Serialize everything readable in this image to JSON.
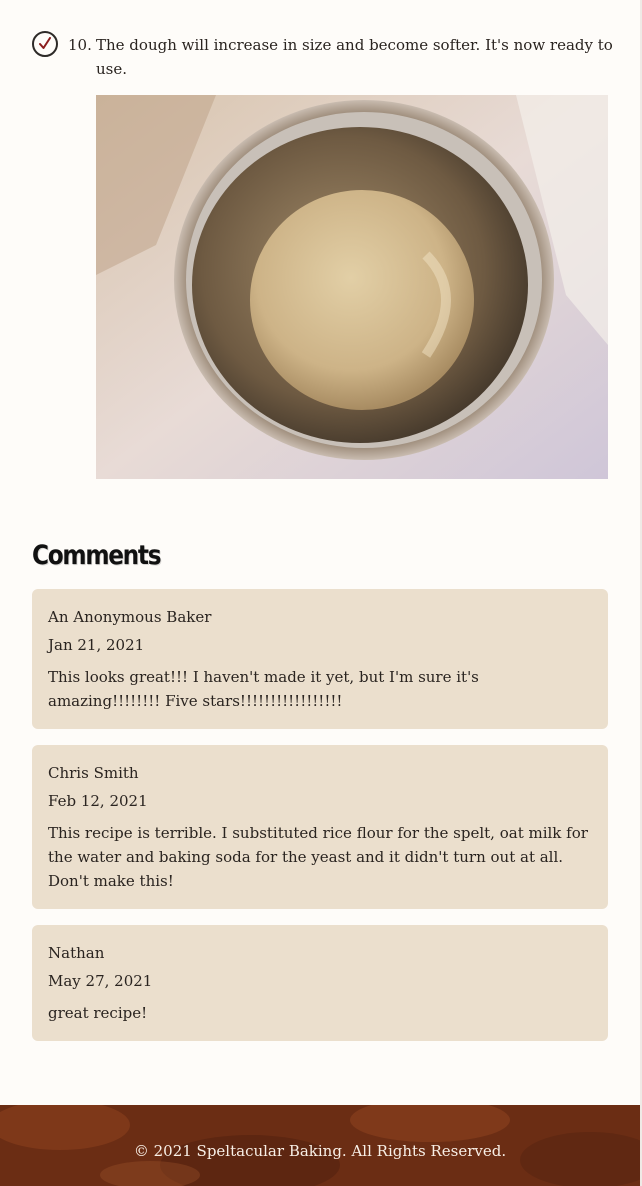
{
  "step": {
    "number": "10.",
    "text": "The dough will increase in size and become softer. It's now ready to use.",
    "checked_icon": "check-circle-icon",
    "photo_icon": "dough-bowl-photo"
  },
  "comments": {
    "title": "Comments",
    "items": [
      {
        "author": "An Anonymous Baker",
        "date": "Jan 21, 2021",
        "text": "This looks great!!! I haven't made it yet, but I'm sure it's amazing!!!!!!!! Five stars!!!!!!!!!!!!!!!!!"
      },
      {
        "author": "Chris Smith",
        "date": "Feb 12, 2021",
        "text": "This recipe is terrible. I substituted rice flour for the spelt, oat milk for the water and baking soda for the yeast and it didn't turn out at all. Don't make this!"
      },
      {
        "author": "Nathan",
        "date": "May 27, 2021",
        "text": "great recipe!"
      }
    ]
  },
  "footer": {
    "copyright": "© 2021 Speltacular Baking. All Rights Reserved."
  },
  "colors": {
    "page_bg": "#fefcf9",
    "comment_bg": "#ebdfcd",
    "footer_bg": "#6b2d14",
    "check_accent": "#8b1d1d"
  }
}
